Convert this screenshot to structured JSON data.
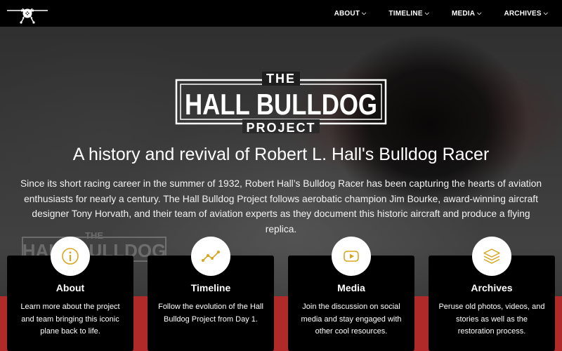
{
  "nav": {
    "logo_icon": "airplane-icon",
    "items": [
      {
        "label": "ABOUT",
        "icon": "chevron-down-icon"
      },
      {
        "label": "TIMELINE",
        "icon": "chevron-down-icon"
      },
      {
        "label": "MEDIA",
        "icon": "chevron-down-icon"
      },
      {
        "label": "ARCHIVES",
        "icon": "chevron-down-icon"
      }
    ]
  },
  "hero": {
    "logo": {
      "line1": "THE",
      "line2": "HALL BULLDOG",
      "line3": "PROJECT"
    },
    "heading": "A history and revival of Robert L. Hall's Bulldog Racer",
    "body": "Since its short racing career in the summer of 1932, Robert Hall’s Bulldog Racer has been capturing the hearts of aviation enthusiasts for nearly a century. The Hall Bulldog Project follows aerobatic champion Jim Bourke, award-winning aircraft designer Tony Horvath, and their team of aviation experts as they document this historic aircraft and produce a flying replica."
  },
  "cards": [
    {
      "icon": "info-icon",
      "title": "About",
      "text": "Learn more about the project and team bringing this iconic plane back to life."
    },
    {
      "icon": "timeline-icon",
      "title": "Timeline",
      "text": "Follow the evolution of the Hall Bulldog Project from Day 1."
    },
    {
      "icon": "video-play-icon",
      "title": "Media",
      "text": "Join the discussion on social media and stay engaged with other cool resources."
    },
    {
      "icon": "layers-icon",
      "title": "Archives",
      "text": "Peruse old photos, videos, and stories as well as the restoration process."
    }
  ],
  "colors": {
    "accent_gold": "#d9a520",
    "band_red": "#b02a2a",
    "nav_bg": "#000000",
    "card_bg": "#000000"
  }
}
